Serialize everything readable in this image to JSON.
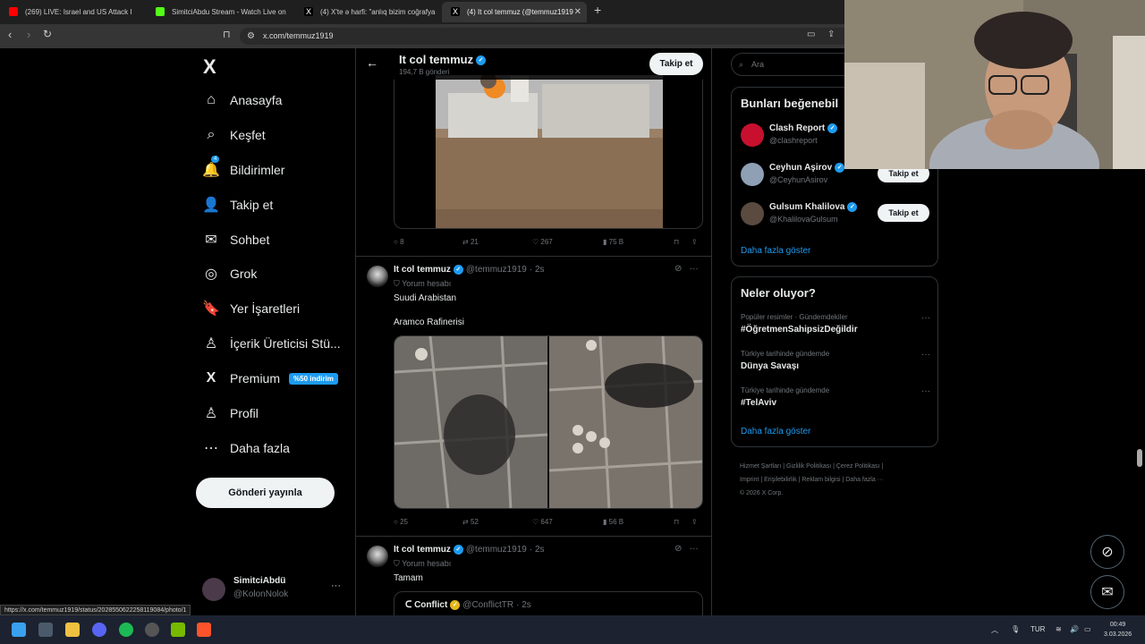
{
  "browser": {
    "tabs": [
      {
        "label": "(269) LIVE: Israel and US Attack I",
        "fav_color": "#ff0000"
      },
      {
        "label": "SimitciAbdu Stream - Watch Live on",
        "fav_color": "#53fc18"
      },
      {
        "label": "(4) X'te ə harfi: \"anlıq bizim coğrafya",
        "fav_color": "#000000"
      },
      {
        "label": "(4) It col temmuz (@temmuz1919",
        "fav_color": "#000000"
      }
    ],
    "url": "x.com/temmuz1919",
    "status_url": "https://x.com/temmuz1919/status/2028550622258119084/photo/1"
  },
  "sidebar": {
    "logo": "X",
    "items": [
      {
        "label": "Anasayfa",
        "icon": "⌂"
      },
      {
        "label": "Keşfet",
        "icon": "⌕"
      },
      {
        "label": "Bildirimler",
        "icon": "🔔",
        "badge": "4"
      },
      {
        "label": "Takip et",
        "icon": "👤"
      },
      {
        "label": "Sohbet",
        "icon": "✉"
      },
      {
        "label": "Grok",
        "icon": "◎"
      },
      {
        "label": "Yer İşaretleri",
        "icon": "🔖"
      },
      {
        "label": "İçerik Üreticisi Stü...",
        "icon": "♙"
      },
      {
        "label": "Premium",
        "icon": "X",
        "badge": "%50 indirim"
      },
      {
        "label": "Profil",
        "icon": "♙"
      },
      {
        "label": "Daha fazla",
        "icon": "⋯"
      }
    ],
    "post_button": "Gönderi yayınla",
    "user": {
      "name": "SimitciAbdü",
      "handle": "@KolonNolok"
    }
  },
  "profile_header": {
    "title": "It col temmuz",
    "post_count": "194,7 B gönderi",
    "follow": "Takip et"
  },
  "tweets": [
    {
      "actions": {
        "reply": "8",
        "retweet": "21",
        "like": "267",
        "views": "75 B"
      }
    },
    {
      "name": "It col temmuz",
      "handle": "@temmuz1919",
      "time": "· 2s",
      "sub": "Yorum hesabı",
      "text1": "Suudi Arabistan",
      "text2": "Aramco Rafinerisi",
      "actions": {
        "reply": "25",
        "retweet": "52",
        "like": "647",
        "views": "56 B"
      }
    },
    {
      "name": "It col temmuz",
      "handle": "@temmuz1919",
      "time": "· 2s",
      "sub": "Yorum hesabı",
      "text1": "Tamam",
      "quote": {
        "name": "Conflict",
        "handle": "@ConflictTR",
        "time": "· 2s"
      }
    }
  ],
  "right": {
    "search_placeholder": "Ara",
    "suggest_title": "Bunları beğenebil",
    "suggestions": [
      {
        "name": "Clash Report",
        "handle": "@clashreport",
        "button": ""
      },
      {
        "name": "Ceyhun Aşirov",
        "handle": "@CeyhunAsirov",
        "button": "Takip et"
      },
      {
        "name": "Gulsum Khalilova",
        "handle": "@KhalilovaGulsum",
        "button": "Takip et"
      }
    ],
    "suggest_more": "Daha fazla göster",
    "trends_title": "Neler oluyor?",
    "trends": [
      {
        "meta": "Popüler resimler · Gündemdekiler",
        "title": "#ÖğretmenSahipsizDeğildir"
      },
      {
        "meta": "Türkiye tarihinde gündemde",
        "title": "Dünya Savaşı"
      },
      {
        "meta": "Türkiye tarihinde gündemde",
        "title": "#TelAviv"
      }
    ],
    "trends_more": "Daha fazla göster",
    "footer_line1": "Hizmet Şartları  |  Gizlilik Politikası  |  Çerez Politikası  |",
    "footer_line2": "Imprint  |  Erişilebilirlik  |  Reklam bilgisi  |  Daha fazla ···",
    "footer_line3": "© 2026 X Corp."
  },
  "taskbar": {
    "lang": "TUR",
    "time": "00:49",
    "date": "3.03.2026"
  }
}
